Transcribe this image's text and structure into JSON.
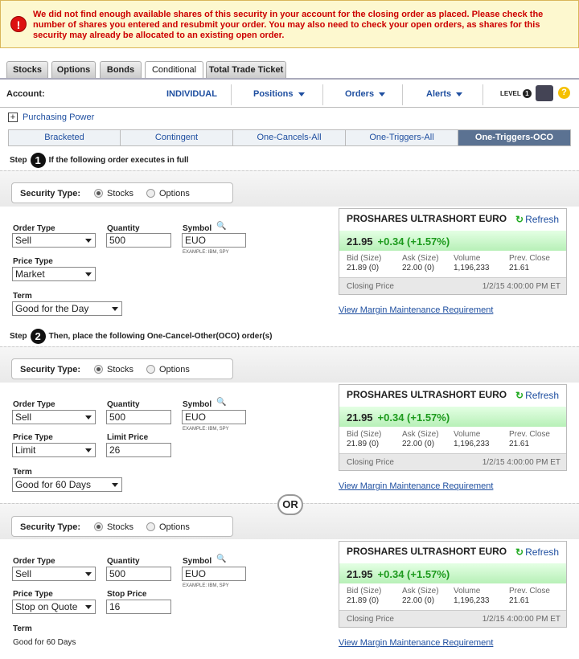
{
  "alert": {
    "icon": "error-icon",
    "message": "We did not find enough available shares of this security in your account for the closing order as placed. Please check the number of shares you entered and resubmit your order. You may also need to check your open orders, as shares for this security may already be allocated to an existing open order."
  },
  "tabs": [
    "Stocks",
    "Options",
    "Bonds",
    "Conditional",
    "Total Trade Ticket"
  ],
  "account": {
    "label": "Account:",
    "value": "INDIVIDUAL",
    "menus": [
      "Positions",
      "Orders",
      "Alerts"
    ],
    "level_label": "LEVEL",
    "level": "1"
  },
  "purchasing_power": "Purchasing Power",
  "subtabs": [
    "Bracketed",
    "Contingent",
    "One-Cancels-All",
    "One-Triggers-All",
    "One-Triggers-OCO"
  ],
  "step1": {
    "label": "Step",
    "num": "1",
    "text": "If the following order executes in full"
  },
  "step2": {
    "label": "Step",
    "num": "2",
    "text": "Then, place the following One-Cancel-Other(OCO) order(s)"
  },
  "or_label": "OR",
  "labels": {
    "security_type": "Security Type:",
    "stocks": "Stocks",
    "options": "Options",
    "order_type": "Order Type",
    "quantity": "Quantity",
    "symbol": "Symbol",
    "example": "EXAMPLE: IBM, SPY",
    "price_type": "Price Type",
    "term": "Term",
    "limit_price": "Limit Price",
    "stop_price": "Stop Price"
  },
  "orders": [
    {
      "order_type": "Sell",
      "quantity": "500",
      "symbol": "EUO",
      "price_type": "Market",
      "term": "Good for the Day"
    },
    {
      "order_type": "Sell",
      "quantity": "500",
      "symbol": "EUO",
      "price_type": "Limit",
      "limit_price": "26",
      "term": "Good for 60 Days"
    },
    {
      "order_type": "Sell",
      "quantity": "500",
      "symbol": "EUO",
      "price_type": "Stop on Quote",
      "stop_price": "16",
      "term": "Good for 60 Days"
    }
  ],
  "quote": {
    "title": "PROSHARES ULTRASHORT EURO",
    "refresh": "Refresh",
    "price": "21.95",
    "change": "+0.34 (+1.57%)",
    "bid_label": "Bid (Size)",
    "bid": "21.89 (0)",
    "ask_label": "Ask (Size)",
    "ask": "22.00 (0)",
    "vol_label": "Volume",
    "volume": "1,196,233",
    "prev_label": "Prev. Close",
    "prev": "21.61",
    "closing_label": "Closing Price",
    "closing_time": "1/2/15 4:00:00 PM ET",
    "margin_link": "View Margin Maintenance Requirement"
  }
}
